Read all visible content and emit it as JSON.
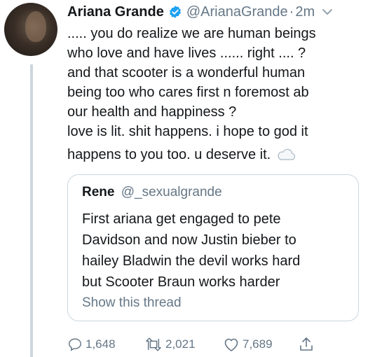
{
  "tweet": {
    "author_name": "Ariana Grande",
    "author_handle": "@ArianaGrande",
    "separator": "·",
    "time": "2m",
    "text_lines": [
      "..... you do realize we are human beings",
      "who love and have lives ...... right .... ?",
      "and that scooter is a wonderful human",
      "being too who cares first n foremost ab",
      "our health and happiness ?",
      "love is lit. shit happens. i hope to god it",
      "happens to you too. u deserve it."
    ],
    "emoji": "cloud-icon"
  },
  "quoted_tweet": {
    "author_name": "Rene",
    "author_handle": "@_sexualgrande",
    "text_lines": [
      "First ariana get engaged to pete",
      "Davidson and now Justin bieber to",
      "hailey Bladwin the devil works hard",
      "but Scooter Braun works harder"
    ],
    "show_thread_label": "Show this thread"
  },
  "actions": {
    "replies": "1,648",
    "retweets": "2,021",
    "likes": "7,689"
  },
  "colors": {
    "text": "#14171a",
    "secondary": "#657786",
    "verified": "#1da1f2",
    "border": "#ccd6dd"
  }
}
